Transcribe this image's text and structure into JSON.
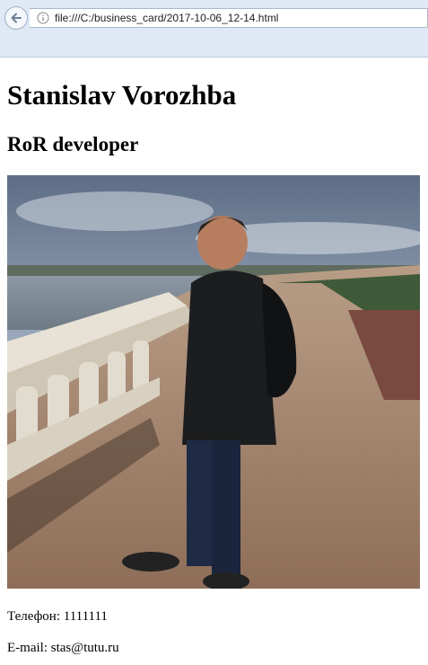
{
  "browser": {
    "url": "file:///C:/business_card/2017-10-06_12-14.html",
    "back_icon": "back-arrow-icon",
    "info_icon": "info-icon"
  },
  "card": {
    "name": "Stanislav Vorozhba",
    "role": "RoR developer",
    "phone_label": "Телефон: ",
    "phone_value": "1111111",
    "email_label": "E-mail: ",
    "email_value": "stas@tutu.ru"
  }
}
